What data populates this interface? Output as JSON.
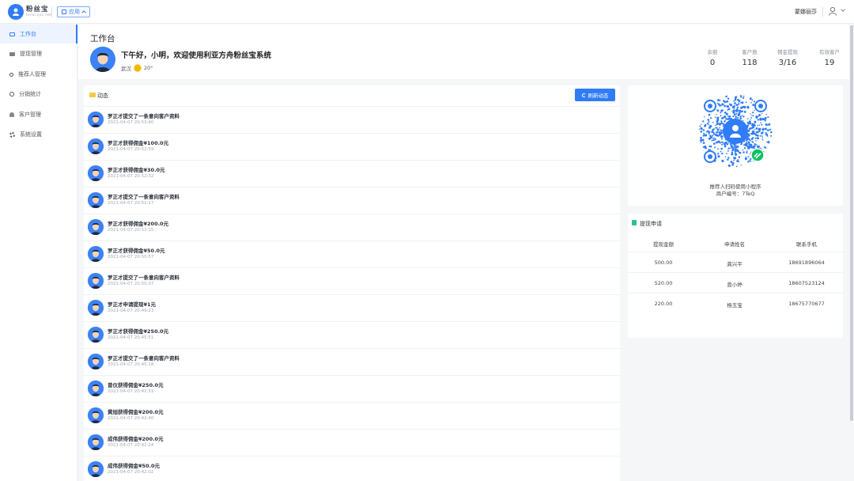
{
  "colors": {
    "accent": "#2f7cf6",
    "wechat_green": "#07c160"
  },
  "brand": {
    "name": "粉丝宝",
    "sub": "fensi.sys.net"
  },
  "topbar": {
    "app_label": "应用",
    "user_name": "蒙娜丽莎"
  },
  "sidebar": {
    "items": [
      {
        "label": "工作台",
        "icon": "desktop-icon",
        "active": true
      },
      {
        "label": "提现管理",
        "icon": "card-icon"
      },
      {
        "label": "推荐人管理",
        "icon": "people-icon"
      },
      {
        "label": "分销统计",
        "icon": "share-icon"
      },
      {
        "label": "客户管理",
        "icon": "customer-icon"
      },
      {
        "label": "系统设置",
        "icon": "gear-icon"
      }
    ]
  },
  "header": {
    "title": "工作台",
    "greeting": "下午好，小明，欢迎使用利亚方舟粉丝宝系统",
    "city": "武汉",
    "temperature": "20°",
    "stats": [
      {
        "label": "余额",
        "value": "0"
      },
      {
        "label": "客户数",
        "value": "118"
      },
      {
        "label": "佣金提现",
        "value": "3/16"
      },
      {
        "label": "有效客户",
        "value": "19"
      }
    ]
  },
  "activity": {
    "title": "动态",
    "refresh_label": "刷新动态",
    "items": [
      {
        "text": "罗正才提交了一条意向客户资料",
        "time": "2021-04-07 20:53:40"
      },
      {
        "text": "罗正才获得佣金¥100.0元",
        "time": "2021-04-07 20:52:59"
      },
      {
        "text": "罗正才获得佣金¥30.0元",
        "time": "2021-04-07 20:52:32"
      },
      {
        "text": "罗正才提交了一条意向客户资料",
        "time": "2021-04-07 20:52:17"
      },
      {
        "text": "罗正才获得佣金¥200.0元",
        "time": "2021-04-07 20:51:15"
      },
      {
        "text": "罗正才获得佣金¥50.0元",
        "time": "2021-04-07 20:50:57"
      },
      {
        "text": "罗正才提交了一条意向客户资料",
        "time": "2021-04-07 20:50:37"
      },
      {
        "text": "罗正才申请提现¥1元",
        "time": "2021-04-07 20:49:23"
      },
      {
        "text": "罗正才获得佣金¥250.0元",
        "time": "2021-04-07 20:45:51"
      },
      {
        "text": "罗正才提交了一条意向客户资料",
        "time": "2021-04-07 20:45:18"
      },
      {
        "text": "曾仪获得佣金¥250.0元",
        "time": "2021-04-07 20:42:51"
      },
      {
        "text": "黄旭获得佣金¥200.0元",
        "time": "2021-04-07 20:42:40"
      },
      {
        "text": "成伟获得佣金¥200.0元",
        "time": "2021-04-07 20:42:24"
      },
      {
        "text": "成伟获得佣金¥50.0元",
        "time": "2021-04-07 20:42:02"
      }
    ]
  },
  "qr": {
    "caption": "推荐人扫码使用小程序",
    "merchant": "商户编号：7TeQ"
  },
  "withdraw": {
    "title": "提现申请",
    "columns": [
      "提现金额",
      "申请姓名",
      "联系手机"
    ],
    "rows": [
      [
        "500.00",
        "龚兴平",
        "18691896064"
      ],
      [
        "520.00",
        "曾小婷",
        "18607523124"
      ],
      [
        "220.00",
        "杨玉宝",
        "18675770677"
      ]
    ]
  }
}
